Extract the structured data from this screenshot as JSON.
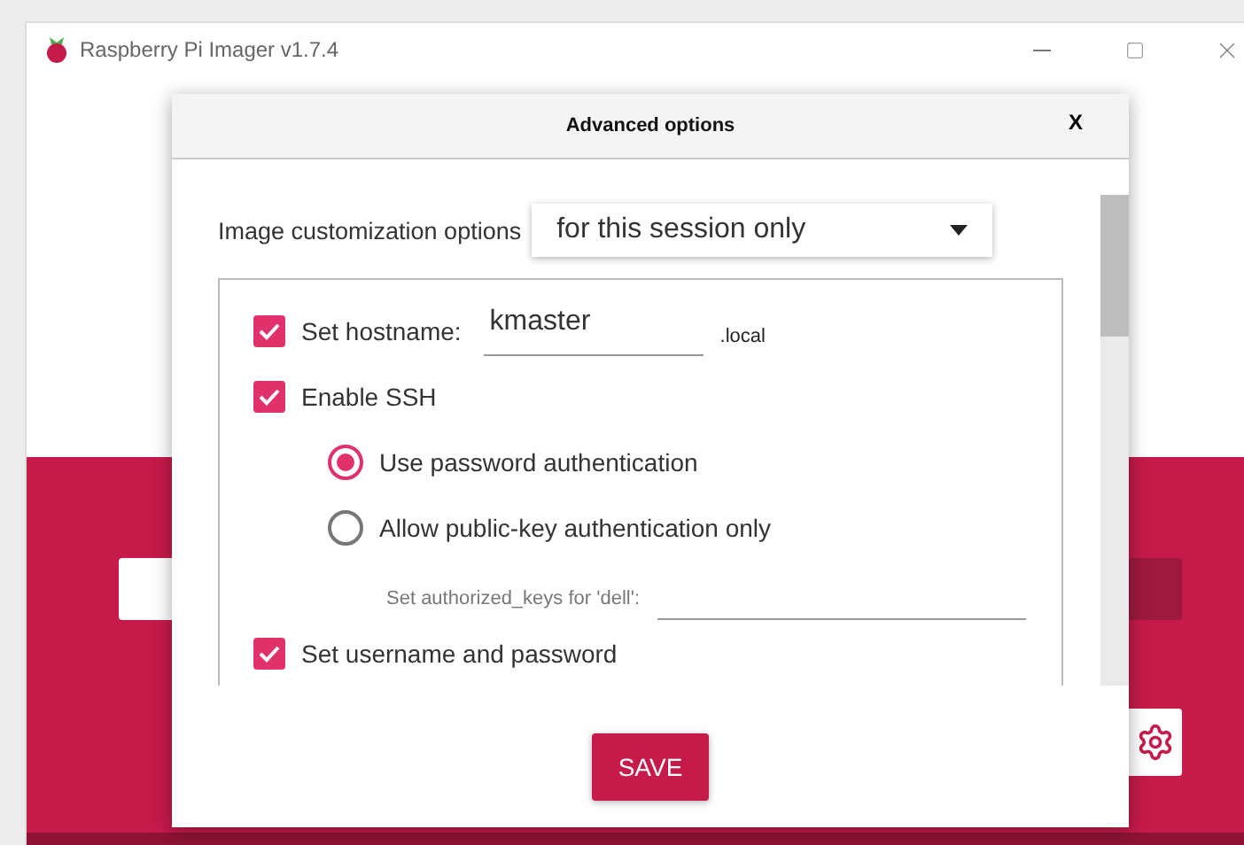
{
  "window": {
    "title": "Raspberry Pi Imager v1.7.4"
  },
  "dialog": {
    "title": "Advanced options",
    "close": "X",
    "customization": {
      "label": "Image customization options",
      "value": "for this session only"
    },
    "options": [
      {
        "kind": "checkbox",
        "label": "Set hostname:",
        "checked": true,
        "field": {
          "value": "kmaster"
        },
        "suffix": ".local"
      },
      {
        "kind": "checkbox",
        "label": "Enable SSH",
        "checked": true,
        "children": [
          {
            "kind": "radio",
            "label": "Use password authentication",
            "selected": true
          },
          {
            "kind": "radio",
            "label": "Allow public-key authentication only",
            "selected": false
          },
          {
            "kind": "keyfield",
            "label": "Set authorized_keys for 'dell':"
          }
        ]
      },
      {
        "kind": "checkbox",
        "label": "Set username and password",
        "checked": true
      }
    ],
    "save": "SAVE"
  }
}
